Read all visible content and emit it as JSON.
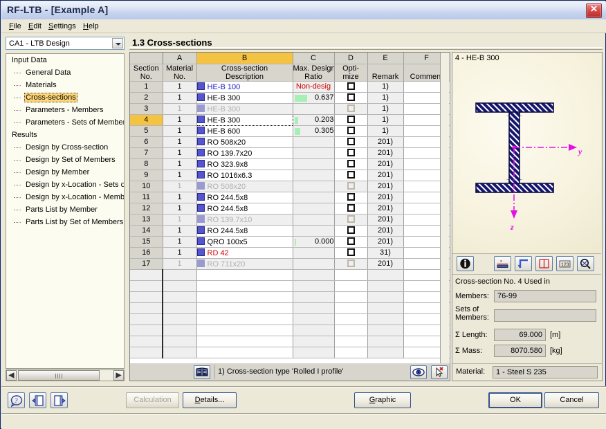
{
  "window": {
    "title": "RF-LTB - [Example A]",
    "close_label": "Close"
  },
  "menu": [
    {
      "label": "File",
      "accel": "F"
    },
    {
      "label": "Edit",
      "accel": "E"
    },
    {
      "label": "Settings",
      "accel": "S"
    },
    {
      "label": "Help",
      "accel": "H"
    }
  ],
  "combo": {
    "value": "CA1 - LTB Design"
  },
  "tree": {
    "nodes": [
      {
        "label": "Input Data",
        "level": 0,
        "selected": false
      },
      {
        "label": "General Data",
        "level": 1,
        "selected": false
      },
      {
        "label": "Materials",
        "level": 1,
        "selected": false
      },
      {
        "label": "Cross-sections",
        "level": 1,
        "selected": true
      },
      {
        "label": "Parameters - Members",
        "level": 1,
        "selected": false
      },
      {
        "label": "Parameters - Sets of Members",
        "level": 1,
        "selected": false
      },
      {
        "label": "Results",
        "level": 0,
        "selected": false
      },
      {
        "label": "Design by Cross-section",
        "level": 1,
        "selected": false
      },
      {
        "label": "Design by Set of Members",
        "level": 1,
        "selected": false
      },
      {
        "label": "Design by Member",
        "level": 1,
        "selected": false
      },
      {
        "label": "Design by x-Location - Sets of M",
        "level": 1,
        "selected": false
      },
      {
        "label": "Design by x-Location - Members",
        "level": 1,
        "selected": false
      },
      {
        "label": "Parts List by Member",
        "level": 1,
        "selected": false
      },
      {
        "label": "Parts List by Set of Members",
        "level": 1,
        "selected": false
      }
    ]
  },
  "main": {
    "section_title": "1.3 Cross-sections",
    "column_letters": [
      "",
      "A",
      "B",
      "C",
      "D",
      "E",
      "F"
    ],
    "active_column_letter": "B",
    "column_headers": [
      "Section\nNo.",
      "Material\nNo.",
      "Cross-section\nDescription",
      "Max. Design\nRatio",
      "Opti-\nmize",
      "Remark",
      "Comment"
    ],
    "rows": [
      {
        "no": "1",
        "material": "1",
        "description": "HE-B 100",
        "ratio": "Non-desig",
        "ratio_kind": "nondesign",
        "bar": 0,
        "optimize": false,
        "remark": "1)",
        "comment": "",
        "dim": false,
        "selected": false,
        "focus": false,
        "text_color": "blue"
      },
      {
        "no": "2",
        "material": "1",
        "description": "HE-B 300",
        "ratio": "0.637",
        "ratio_kind": "value",
        "bar": 18,
        "optimize": false,
        "remark": "1)",
        "comment": "",
        "dim": false,
        "selected": false,
        "focus": false,
        "text_color": "black"
      },
      {
        "no": "3",
        "material": "1",
        "description": "HE-B 300",
        "ratio": "",
        "ratio_kind": "empty",
        "bar": 0,
        "optimize": false,
        "remark": "1)",
        "comment": "",
        "dim": true,
        "selected": false,
        "focus": false,
        "text_color": "grey"
      },
      {
        "no": "4",
        "material": "1",
        "description": "HE-B 300",
        "ratio": "0.203",
        "ratio_kind": "value",
        "bar": 5,
        "optimize": false,
        "remark": "1)",
        "comment": "",
        "dim": false,
        "selected": true,
        "focus": true,
        "text_color": "black"
      },
      {
        "no": "5",
        "material": "1",
        "description": "HE-B 600",
        "ratio": "0.305",
        "ratio_kind": "value",
        "bar": 8,
        "optimize": false,
        "remark": "1)",
        "comment": "",
        "dim": false,
        "selected": false,
        "focus": false,
        "text_color": "black"
      },
      {
        "no": "6",
        "material": "1",
        "description": "RO 508x20",
        "ratio": "",
        "ratio_kind": "empty",
        "bar": 0,
        "optimize": false,
        "remark": "201)",
        "comment": "",
        "dim": false,
        "selected": false,
        "focus": false,
        "text_color": "black"
      },
      {
        "no": "7",
        "material": "1",
        "description": "RO 139.7x20",
        "ratio": "",
        "ratio_kind": "empty",
        "bar": 0,
        "optimize": false,
        "remark": "201)",
        "comment": "",
        "dim": false,
        "selected": false,
        "focus": false,
        "text_color": "black"
      },
      {
        "no": "8",
        "material": "1",
        "description": "RO 323.9x8",
        "ratio": "",
        "ratio_kind": "empty",
        "bar": 0,
        "optimize": false,
        "remark": "201)",
        "comment": "",
        "dim": false,
        "selected": false,
        "focus": false,
        "text_color": "black"
      },
      {
        "no": "9",
        "material": "1",
        "description": "RO 1016x6.3",
        "ratio": "",
        "ratio_kind": "empty",
        "bar": 0,
        "optimize": false,
        "remark": "201)",
        "comment": "",
        "dim": false,
        "selected": false,
        "focus": false,
        "text_color": "black"
      },
      {
        "no": "10",
        "material": "1",
        "description": "RO 508x20",
        "ratio": "",
        "ratio_kind": "empty",
        "bar": 0,
        "optimize": false,
        "remark": "201)",
        "comment": "",
        "dim": true,
        "selected": false,
        "focus": false,
        "text_color": "grey"
      },
      {
        "no": "11",
        "material": "1",
        "description": "RO 244.5x8",
        "ratio": "",
        "ratio_kind": "empty",
        "bar": 0,
        "optimize": false,
        "remark": "201)",
        "comment": "",
        "dim": false,
        "selected": false,
        "focus": false,
        "text_color": "black"
      },
      {
        "no": "12",
        "material": "1",
        "description": "RO 244.5x8",
        "ratio": "",
        "ratio_kind": "empty",
        "bar": 0,
        "optimize": false,
        "remark": "201)",
        "comment": "",
        "dim": false,
        "selected": false,
        "focus": false,
        "text_color": "black"
      },
      {
        "no": "13",
        "material": "1",
        "description": "RO 139.7x10",
        "ratio": "",
        "ratio_kind": "empty",
        "bar": 0,
        "optimize": false,
        "remark": "201)",
        "comment": "",
        "dim": true,
        "selected": false,
        "focus": false,
        "text_color": "grey"
      },
      {
        "no": "14",
        "material": "1",
        "description": "RO 244.5x8",
        "ratio": "",
        "ratio_kind": "empty",
        "bar": 0,
        "optimize": false,
        "remark": "201)",
        "comment": "",
        "dim": false,
        "selected": false,
        "focus": false,
        "text_color": "black"
      },
      {
        "no": "15",
        "material": "1",
        "description": "QRO 100x5",
        "ratio": "0.000",
        "ratio_kind": "value",
        "bar": 2,
        "optimize": false,
        "remark": "201)",
        "comment": "",
        "dim": false,
        "selected": false,
        "focus": false,
        "text_color": "black"
      },
      {
        "no": "16",
        "material": "1",
        "description": "RD 42",
        "ratio": "",
        "ratio_kind": "empty",
        "bar": 0,
        "optimize": false,
        "remark": "31)",
        "comment": "",
        "dim": false,
        "selected": false,
        "focus": false,
        "text_color": "red"
      },
      {
        "no": "17",
        "material": "1",
        "description": "RO 711x20",
        "ratio": "",
        "ratio_kind": "empty",
        "bar": 0,
        "optimize": false,
        "remark": "201)",
        "comment": "",
        "dim": true,
        "selected": false,
        "focus": false,
        "text_color": "grey"
      }
    ],
    "remark_note": "1) Cross-section type 'Rolled I profile'"
  },
  "right": {
    "graphic_caption": "4 - HE-B 300",
    "axis_y_label": "y",
    "axis_z_label": "z",
    "info_title": "Cross-section No. 4 Used in",
    "members_label": "Members:",
    "members_value": "76-99",
    "sets_label": "Sets of\nMembers:",
    "sets_value": "",
    "length_label": "Σ Length:",
    "length_value": "69.000",
    "length_unit": "[m]",
    "mass_label": "Σ Mass:",
    "mass_value": "8070.580",
    "mass_unit": "[kg]",
    "material_label": "Material:",
    "material_value": "1 - Steel S 235"
  },
  "footer": {
    "calculation_label": "Calculation",
    "details_label": "Details...",
    "graphic_label": "Graphic",
    "ok_label": "OK",
    "cancel_label": "Cancel"
  },
  "colors": {
    "accent": "#f5c342",
    "title_gradient_end": "#bac9ea",
    "section_swatch": "#5555cf",
    "ratio_bar": "#a6f0b5",
    "error_text": "#d40000",
    "link_text": "#1515c8",
    "beam_fill": "#15166e",
    "axis": "#e310e3"
  }
}
